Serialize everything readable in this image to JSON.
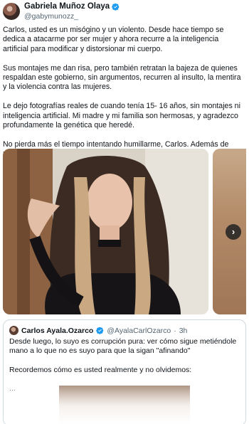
{
  "author": {
    "name": "Gabriela Muñoz Olaya",
    "handle": "@gabymunozz_",
    "verified_color": "#1d9bf0"
  },
  "tweet": {
    "paragraphs": [
      "Carlos, usted es un misógino y un violento. Desde hace tiempo se dedica a atacarme por ser mujer y ahora recurre a la inteligencia artificial para modificar y distorsionar mi cuerpo.",
      "Sus montajes me dan risa, pero también retratan la bajeza de quienes respaldan este gobierno, sin argumentos, recurren al insulto, la mentira y la violencia contra las mujeres.",
      "Le dejo fotografías reales de cuando tenía 15- 16 años, sin montajes ni inteligencia artificial. Mi madre y mi familia son hermosas, y agradezco profundamente la genética que heredé.",
      "No pierda más el tiempo intentando humillarme, Carlos. Además de misógino, se ve patético."
    ]
  },
  "media": {
    "next_icon": "chevron-right-icon",
    "next_glyph": "›"
  },
  "quote": {
    "name": "Carlos Ayala.Ozarco",
    "handle": "@AyalaCarlOzarco",
    "separator": "·",
    "time": "3h",
    "paragraphs": [
      "Desde luego, lo suyo es corrupción pura: ver cómo sigue metiéndole mano a lo que no es suyo para que la sigan \"afinando\"",
      "Recordemos cómo es usted realmente y no olvidemos:",
      "..."
    ]
  }
}
